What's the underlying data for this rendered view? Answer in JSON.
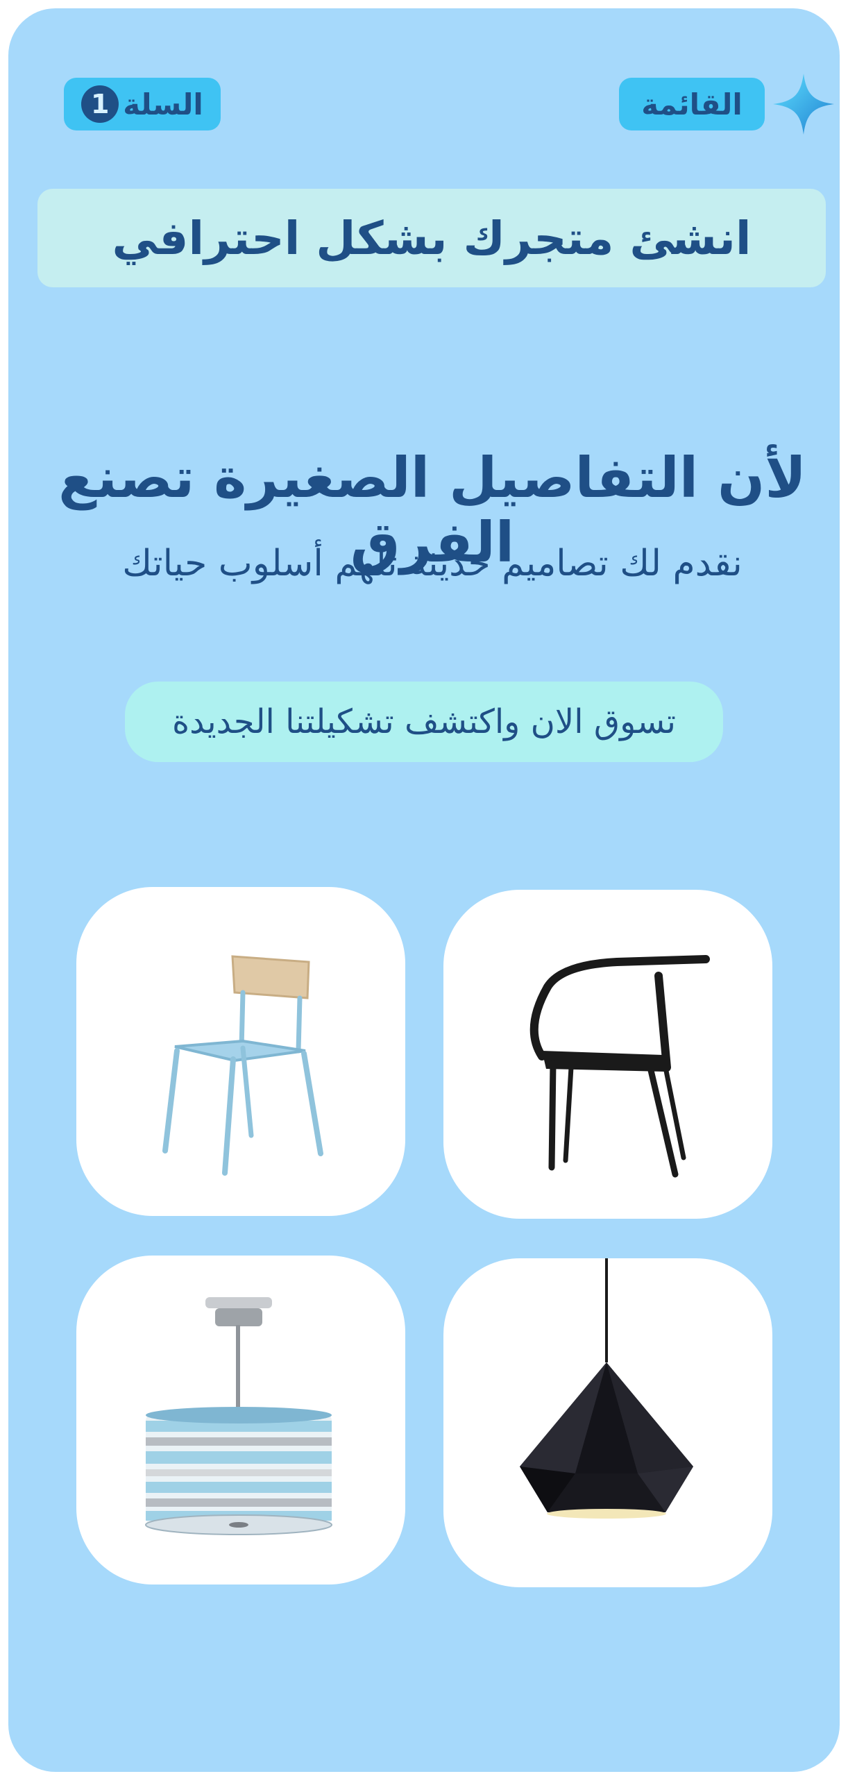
{
  "header": {
    "logo_icon": "sparkle-star-icon",
    "menu_label": "القائمة",
    "cart_label": "السلة",
    "cart_count": "1"
  },
  "banner": {
    "text": "انشئ متجرك بشكل احترافي"
  },
  "hero": {
    "title": "لأن التفاصيل الصغيرة تصنع الفرق",
    "subtitle": "نقدم لك تصاميم حديثة تلهم أسلوب حياتك"
  },
  "cta": {
    "label": "تسوق الان واكتشف تشكيلتنا الجديدة"
  },
  "products": [
    {
      "icon": "light-blue-chair-icon"
    },
    {
      "icon": "black-armchair-icon"
    },
    {
      "icon": "striped-drum-pendant-lamp-icon"
    },
    {
      "icon": "black-geometric-pendant-lamp-icon"
    }
  ],
  "colors": {
    "background": "#a6d9fb",
    "accent": "#3fc3f3",
    "text": "#1f4f86",
    "banner": "#c5eef0",
    "cta": "#aef1f0"
  }
}
